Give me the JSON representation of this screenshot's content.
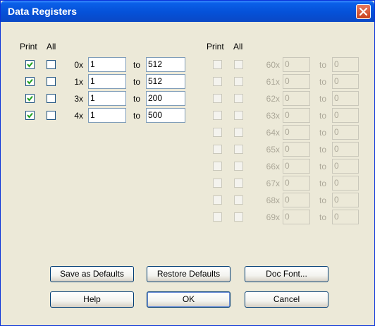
{
  "window": {
    "title": "Data Registers"
  },
  "left": {
    "print_header": "Print",
    "all_header": "All",
    "to_label": "to",
    "rows": [
      {
        "label": "0x",
        "print": true,
        "all": false,
        "from": "1",
        "to": "512"
      },
      {
        "label": "1x",
        "print": true,
        "all": false,
        "from": "1",
        "to": "512"
      },
      {
        "label": "3x",
        "print": true,
        "all": false,
        "from": "1",
        "to": "200"
      },
      {
        "label": "4x",
        "print": true,
        "all": false,
        "from": "1",
        "to": "500"
      }
    ]
  },
  "right": {
    "print_header": "Print",
    "all_header": "All",
    "to_label": "to",
    "rows": [
      {
        "label": "60x",
        "from": "0",
        "to": "0"
      },
      {
        "label": "61x",
        "from": "0",
        "to": "0"
      },
      {
        "label": "62x",
        "from": "0",
        "to": "0"
      },
      {
        "label": "63x",
        "from": "0",
        "to": "0"
      },
      {
        "label": "64x",
        "from": "0",
        "to": "0"
      },
      {
        "label": "65x",
        "from": "0",
        "to": "0"
      },
      {
        "label": "66x",
        "from": "0",
        "to": "0"
      },
      {
        "label": "67x",
        "from": "0",
        "to": "0"
      },
      {
        "label": "68x",
        "from": "0",
        "to": "0"
      },
      {
        "label": "69x",
        "from": "0",
        "to": "0"
      }
    ]
  },
  "buttons": {
    "save_defaults": "Save as Defaults",
    "restore_defaults": "Restore Defaults",
    "doc_font": "Doc Font...",
    "help": "Help",
    "ok": "OK",
    "cancel": "Cancel"
  },
  "colors": {
    "titlebar": "#0551d8",
    "dialog_bg": "#ece9d8",
    "close": "#c8411d"
  }
}
